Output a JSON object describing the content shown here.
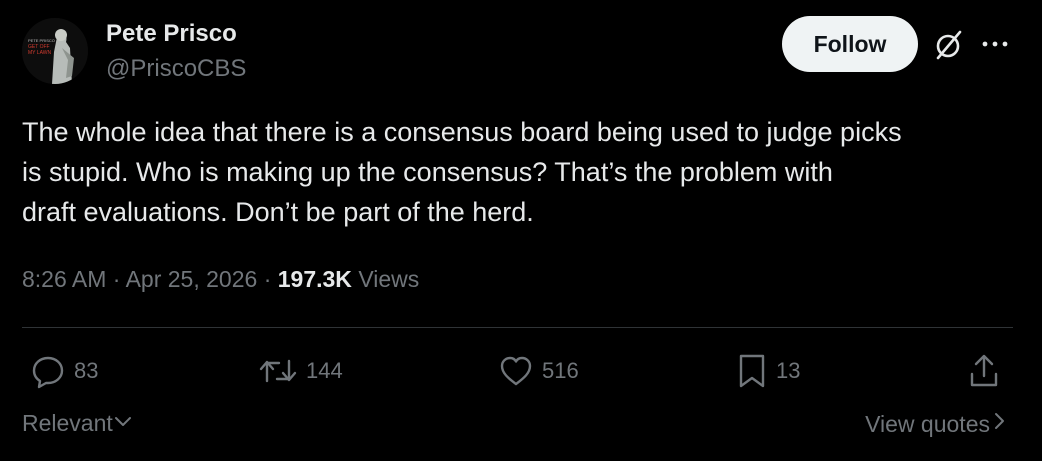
{
  "author": {
    "name": "Pete Prisco",
    "handle": "@PriscoCBS",
    "avatar_text": [
      "PETE PRISCO",
      "GET OFF",
      "MY LAWN"
    ]
  },
  "header": {
    "follow_label": "Follow",
    "icons": [
      "grok-icon",
      "more-icon"
    ]
  },
  "tweet": {
    "lines": [
      "The whole idea that there is a consensus board being used to judge picks",
      "is stupid. Who is making up the consensus? That’s the problem with",
      "draft evaluations. Don’t be part of the herd."
    ]
  },
  "meta": {
    "time": "8:26 AM",
    "separator": "·",
    "date": "Apr 25, 2026",
    "views_count": "197.3K",
    "views_label": "Views"
  },
  "actions": {
    "replies": "83",
    "reposts": "144",
    "likes": "516",
    "bookmarks": "13"
  },
  "footer": {
    "sort_label": "Relevant",
    "view_quotes_label": "View quotes"
  },
  "colors": {
    "background": "#000000",
    "primary_text": "#e7e9ea",
    "secondary_text": "#71767b",
    "follow_bg": "#eff3f4",
    "divider": "#2f3336"
  }
}
